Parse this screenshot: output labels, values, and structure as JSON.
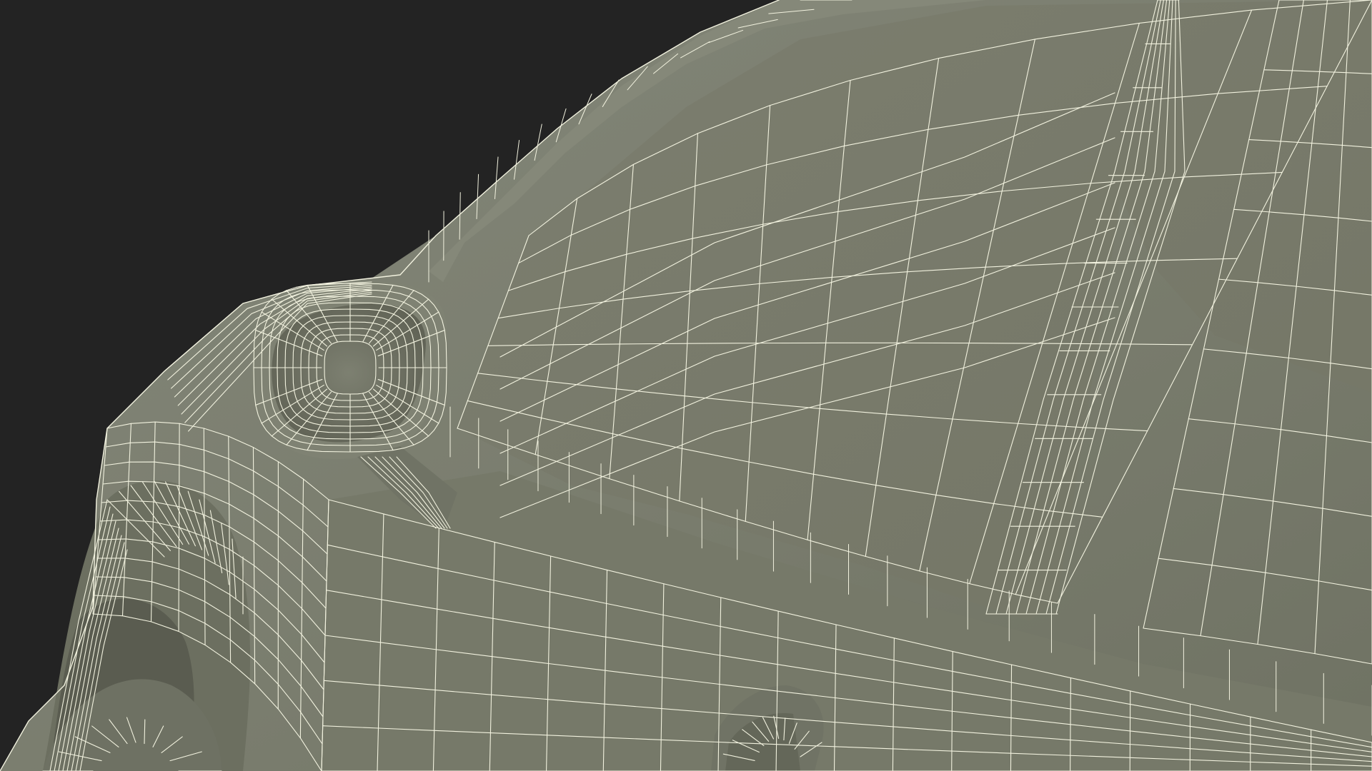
{
  "scene": {
    "subject": "",
    "colors": {
      "background": "#232323",
      "surface": "#7a7c6c",
      "surface_shadow": "#6b6d5e",
      "surface_light": "#878a78",
      "wire": "#f2f2df"
    }
  }
}
